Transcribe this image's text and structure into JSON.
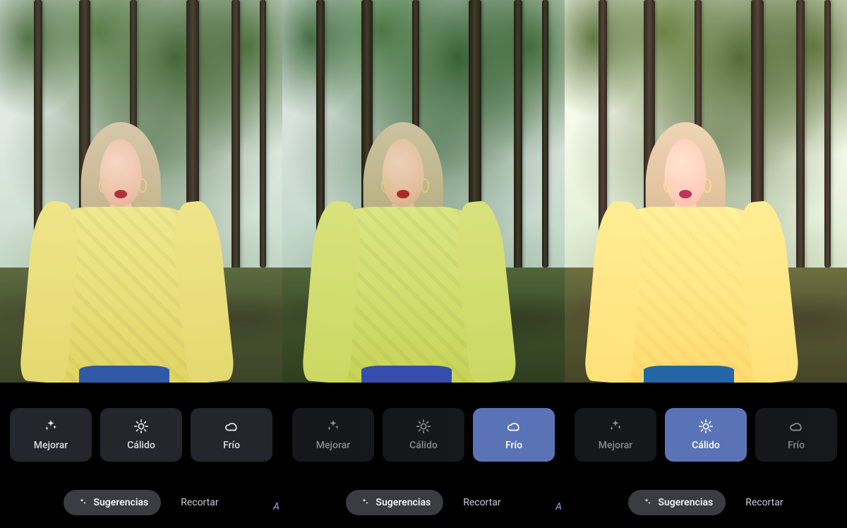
{
  "labels": {
    "option_enhance": "Mejorar",
    "option_warm": "Cálido",
    "option_cool": "Frío",
    "bottom_primary": "Sugerencias",
    "bottom_secondary": "Recortar",
    "edge_hint": "A"
  },
  "panels": [
    {
      "variant": "normal",
      "selected_option": null,
      "options_dimmed": false,
      "show_edge_hint": true
    },
    {
      "variant": "cool",
      "selected_option": "cool",
      "options_dimmed": true,
      "show_edge_hint": true
    },
    {
      "variant": "warm",
      "selected_option": "warm",
      "options_dimmed": true,
      "show_edge_hint": false
    }
  ]
}
